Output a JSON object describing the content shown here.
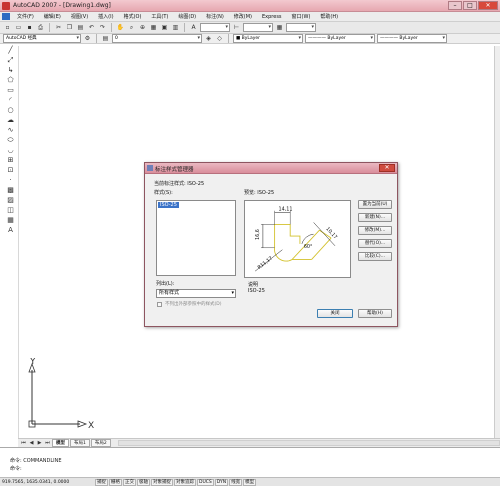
{
  "window": {
    "title": "AutoCAD 2007 - [Drawing1.dwg]",
    "min": "–",
    "max": "□",
    "close": "✕"
  },
  "menu": [
    "文件(F)",
    "编辑(E)",
    "视图(V)",
    "插入(I)",
    "格式(O)",
    "工具(T)",
    "绘图(D)",
    "标注(N)",
    "修改(M)",
    "Express",
    "窗口(W)",
    "帮助(H)"
  ],
  "toolbar": {
    "workspace": "AutoCAD 经典",
    "layer": "0",
    "color": "■ ByLayer",
    "linetype": "———— ByLayer",
    "lineweight": "———— ByLayer"
  },
  "layout_tabs": {
    "model": "模型",
    "layout1": "布局1",
    "layout2": "布局2"
  },
  "command": {
    "line1": "命令: COMMANDLINE",
    "line2": "命令:"
  },
  "status": {
    "coords": "919.7565, 1635.0341, 0.0000",
    "buttons": [
      "捕捉",
      "栅格",
      "正交",
      "极轴",
      "对象捕捉",
      "对象追踪",
      "DUCS",
      "DYN",
      "线宽",
      "模型"
    ]
  },
  "ucs": {
    "y": "Y",
    "x": "X"
  },
  "dialog": {
    "title": "标注样式管理器",
    "current_style_label": "当前标注样式: ISO-25",
    "styles_label": "样式(S):",
    "styles": [
      "ISO-25"
    ],
    "preview_label": "预览: ISO-25",
    "list_label": "列出(L):",
    "list_value": "所有样式",
    "checkbox_label": "不列出外部参照中的样式(D)",
    "description_label": "说明",
    "description_value": "ISO-25",
    "buttons": {
      "set_current": "置为当前(U)",
      "new": "新建(N)...",
      "modify": "修改(M)...",
      "override": "替代(O)...",
      "compare": "比较(C)...",
      "close": "关闭",
      "help": "帮助(H)"
    },
    "preview_dims": {
      "top": "14,11",
      "left": "16,6",
      "diag": "10,17",
      "angle": "60°",
      "radius": "R11,17"
    }
  }
}
